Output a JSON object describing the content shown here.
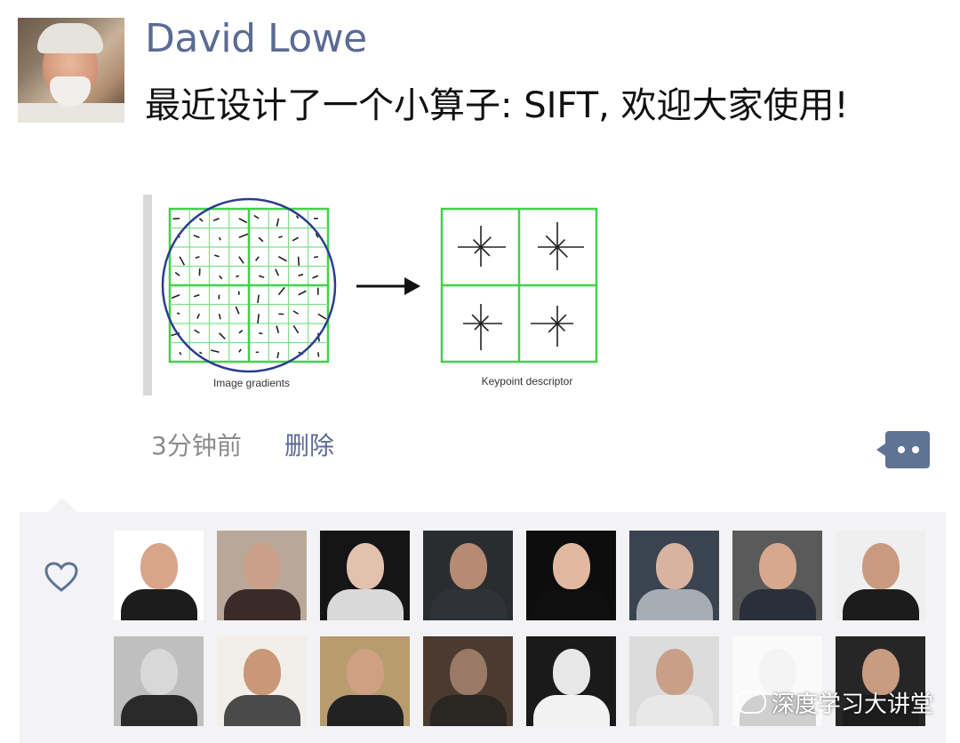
{
  "post": {
    "author": "David Lowe",
    "text": "最近设计了一个小算子: SIFT, 欢迎大家使用!",
    "time": "3分钟前",
    "delete_label": "删除"
  },
  "figure": {
    "left_caption": "Image gradients",
    "right_caption": "Keypoint descriptor"
  },
  "likes": {
    "icon": "heart-outline-icon",
    "likers": [
      {
        "bg": "#ffffff",
        "skin": "#d9a58a",
        "cloth": "#1c1c1c"
      },
      {
        "bg": "#b9a89a",
        "skin": "#caa08a",
        "cloth": "#3a2a28"
      },
      {
        "bg": "#151515",
        "skin": "#e2c2ad",
        "cloth": "#d9d9d9"
      },
      {
        "bg": "#2a2d30",
        "skin": "#b68b72",
        "cloth": "#2f3238"
      },
      {
        "bg": "#0d0d0d",
        "skin": "#e0b9a0",
        "cloth": "#0f0f0f"
      },
      {
        "bg": "#3a4450",
        "skin": "#d6b4a0",
        "cloth": "#a7acb5"
      },
      {
        "bg": "#5a5a5a",
        "skin": "#d7a88e",
        "cloth": "#2a2f3a"
      },
      {
        "bg": "#efefef",
        "skin": "#c99a80",
        "cloth": "#1c1c1c"
      },
      {
        "bg": "#bfbfbf",
        "skin": "#d8d8d8",
        "cloth": "#2a2a2a"
      },
      {
        "bg": "#f2efe8",
        "skin": "#c99878",
        "cloth": "#4a4a4a"
      },
      {
        "bg": "#b89c70",
        "skin": "#cfa083",
        "cloth": "#222222"
      },
      {
        "bg": "#4a3a30",
        "skin": "#9a7a66",
        "cloth": "#2a2622"
      },
      {
        "bg": "#1a1a1a",
        "skin": "#e7e7e7",
        "cloth": "#f2f2f2"
      },
      {
        "bg": "#dcdcdc",
        "skin": "#c8a088",
        "cloth": "#e8e8e8"
      },
      {
        "bg": "#fafafa",
        "skin": "#f4f4f4",
        "cloth": "#cfcfcf"
      },
      {
        "bg": "#262626",
        "skin": "#c89c80",
        "cloth": "#1d1d1d"
      }
    ]
  },
  "watermark": {
    "text": "深度学习大讲堂"
  },
  "colors": {
    "name": "#5b6b94",
    "grid_green": "#41d14b",
    "circle_blue": "#2a3d8f",
    "likes_bg": "#f3f3f5"
  }
}
